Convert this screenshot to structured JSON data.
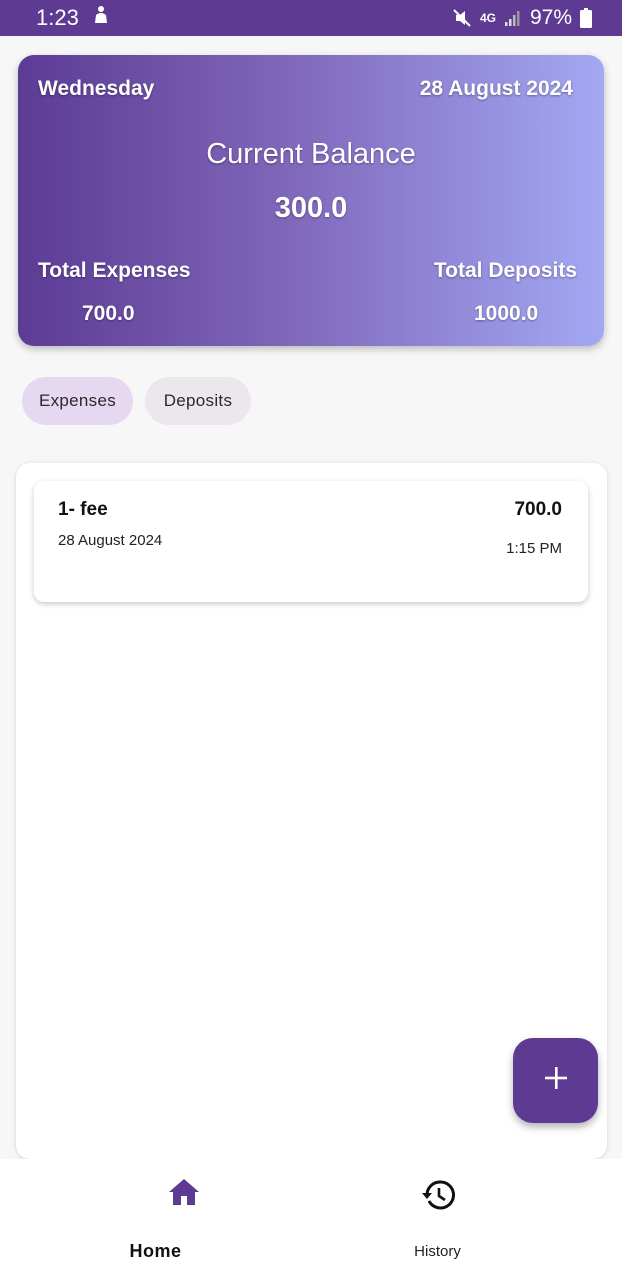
{
  "status_bar": {
    "time": "1:23",
    "network": "4G",
    "battery": "97%"
  },
  "balance_card": {
    "day": "Wednesday",
    "date": "28 August 2024",
    "current_balance_label": "Current Balance",
    "current_balance_value": "300.0",
    "total_expenses_label": "Total Expenses",
    "total_expenses_value": "700.0",
    "total_deposits_label": "Total Deposits",
    "total_deposits_value": "1000.0"
  },
  "tabs": [
    {
      "label": "Expenses",
      "selected": true
    },
    {
      "label": "Deposits",
      "selected": false
    }
  ],
  "transactions": [
    {
      "title": "1- fee",
      "date": "28 August 2024",
      "amount": "700.0",
      "time": "1:15 PM"
    }
  ],
  "fab": {
    "icon": "plus-icon"
  },
  "bottom_nav": [
    {
      "label": "Home",
      "icon": "home-icon",
      "selected": true
    },
    {
      "label": "History",
      "icon": "history-icon",
      "selected": false
    }
  ],
  "colors": {
    "primary": "#5e3a92",
    "gradient_end": "#a3a8f3",
    "tab_selected": "#e6d8f0",
    "tab_unselected": "#ebe7ec"
  }
}
